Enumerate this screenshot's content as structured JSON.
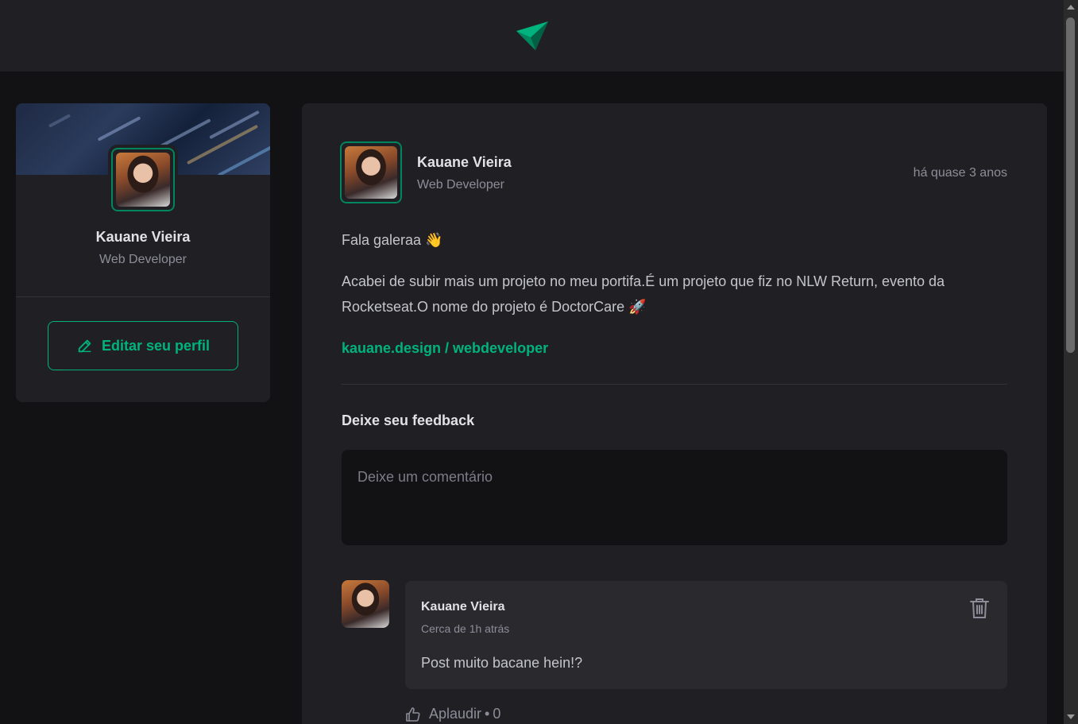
{
  "colors": {
    "accent": "#00b37e",
    "accent_border": "#00875f",
    "background": "#121214",
    "surface": "#202024",
    "card": "#29292e",
    "muted": "#8d8d99"
  },
  "header": {
    "logo_icon": "paper-plane-logo-icon"
  },
  "sidebar": {
    "name": "Kauane Vieira",
    "role": "Web Developer",
    "edit_label": "Editar seu perfil",
    "edit_icon": "pencil-icon"
  },
  "post": {
    "author_name": "Kauane Vieira",
    "author_role": "Web Developer",
    "time": "há quase 3 anos",
    "greeting": "Fala galeraa 👋",
    "body": "Acabei de subir mais um projeto no meu portifa.É um projeto que fiz no NLW Return, evento da Rocketseat.O nome do projeto é DoctorCare 🚀",
    "link": "kauane.design / webdeveloper",
    "feedback_title": "Deixe seu feedback",
    "comment_placeholder": "Deixe um comentário"
  },
  "comments": [
    {
      "name": "Kauane Vieira",
      "time": "Cerca de 1h atrás",
      "text": "Post muito bacane hein!?",
      "applaud_label": "Aplaudir",
      "applaud_separator": "•",
      "applaud_count": "0",
      "delete_icon": "trash-icon",
      "applaud_icon": "thumbs-up-icon"
    }
  ]
}
